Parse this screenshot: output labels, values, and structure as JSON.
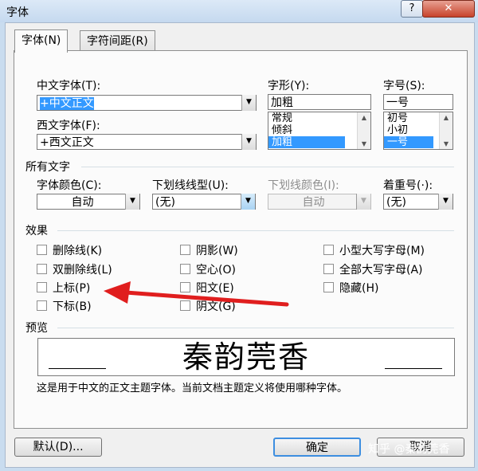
{
  "window": {
    "title": "字体",
    "help_label": "?",
    "close_label": "✕"
  },
  "tabs": [
    {
      "label": "字体(N)"
    },
    {
      "label": "字符间距(R)"
    }
  ],
  "font": {
    "cn_font_label": "中文字体(T):",
    "cn_font_value": "+中文正文",
    "west_font_label": "西文字体(F):",
    "west_font_value": "+西文正文",
    "style_label": "字形(Y):",
    "style_value": "加粗",
    "style_options": [
      "常规",
      "倾斜",
      "加粗"
    ],
    "size_label": "字号(S):",
    "size_value": "一号",
    "size_options": [
      "初号",
      "小初",
      "一号"
    ]
  },
  "all_text": {
    "title": "所有文字",
    "color_label": "字体颜色(C):",
    "color_value": "自动",
    "underline_label": "下划线线型(U):",
    "underline_value": "(无)",
    "underline_color_label": "下划线颜色(I):",
    "underline_color_value": "自动",
    "emphasis_label": "着重号(·):",
    "emphasis_value": "(无)"
  },
  "effects": {
    "title": "效果",
    "col1": [
      "删除线(K)",
      "双删除线(L)",
      "上标(P)",
      "下标(B)"
    ],
    "col2": [
      "阴影(W)",
      "空心(O)",
      "阳文(E)",
      "阴文(G)"
    ],
    "col3": [
      "小型大写字母(M)",
      "全部大写字母(A)",
      "隐藏(H)"
    ]
  },
  "preview": {
    "title": "预览",
    "sample": "秦韵莞香",
    "description": "这是用于中文的正文主题字体。当前文档主题定义将使用哪种字体。"
  },
  "buttons": {
    "default": "默认(D)...",
    "ok": "确定",
    "cancel": "取消"
  },
  "watermark": "知乎 @秦韵莞香",
  "annotation": {
    "arrow_color": "#e01e1e"
  }
}
